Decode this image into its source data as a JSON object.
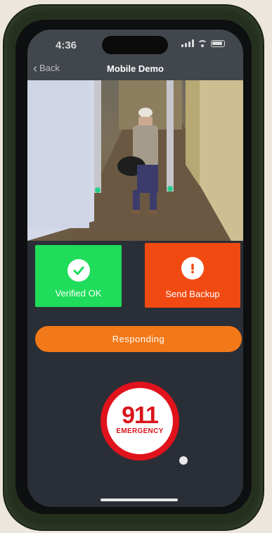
{
  "status_bar": {
    "time": "4:36",
    "icons": [
      "signal-icon",
      "wifi-icon",
      "battery-icon"
    ]
  },
  "nav": {
    "back_label": "Back",
    "title": "Mobile Demo"
  },
  "camera_feed": {
    "description_icon": "camera-feed"
  },
  "actions": {
    "verified_label": "Verified OK",
    "verified_icon": "checkmark-icon",
    "verified_color": "#1fdc5a",
    "backup_label": "Send Backup",
    "backup_icon": "exclamation-icon",
    "backup_color": "#f04a12",
    "responding_label": "Responding",
    "responding_color": "#f27818"
  },
  "emergency": {
    "number": "911",
    "label": "EMERGENCY",
    "color": "#e0121c"
  }
}
